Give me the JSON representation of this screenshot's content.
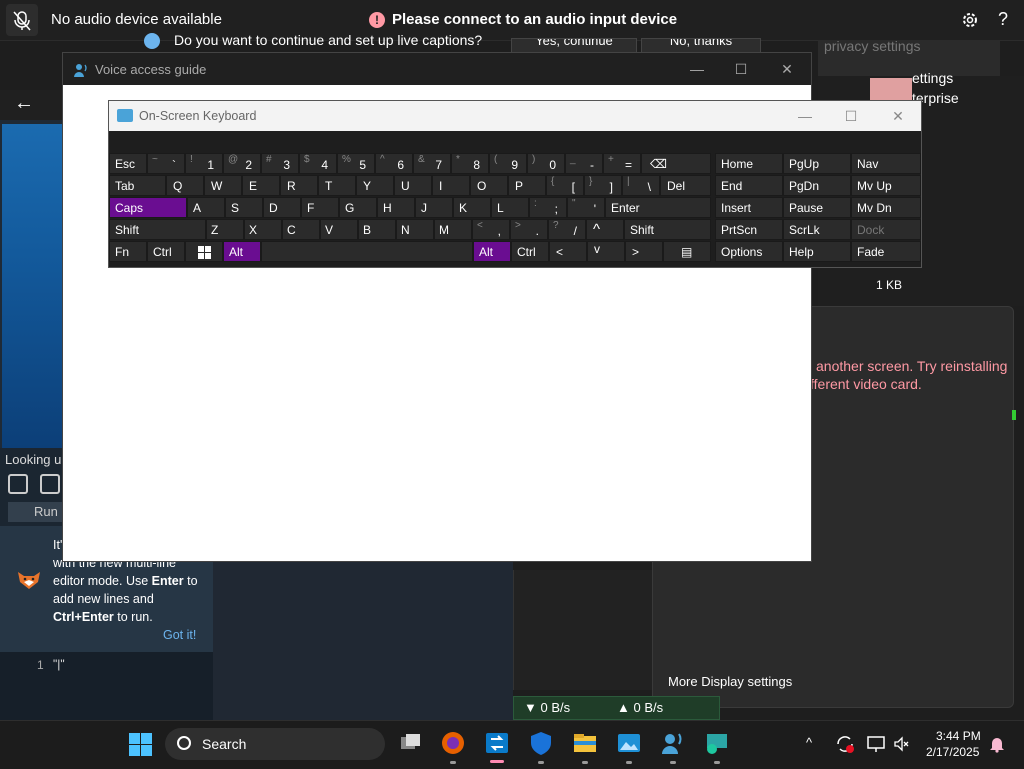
{
  "voice_bar": {
    "status": "No audio device available",
    "alert": "Please connect to an audio input device",
    "alert_icon": "!",
    "help": "?"
  },
  "captions_prompt": {
    "text": "Do you want to continue and set up live captions?",
    "continue_label": "Yes, continue",
    "decline_label": "No, thanks",
    "privacy_label": "privacy settings"
  },
  "background": {
    "looking_up": "Looking up",
    "run_label": "Run",
    "tip_line1": "It's",
    "tip_line2": "with the new multi-line",
    "tip_line3": "editor mode. Use",
    "tip_enter": "Enter",
    "tip_line3b": "to",
    "tip_line4": "add new lines and",
    "tip_ctrlenter": "Ctrl+Enter",
    "tip_line5": "to run.",
    "got_it": "Got it!",
    "line_number": "1",
    "line_code": "\"|\"",
    "settings_partial1": "ettings",
    "settings_partial2": "terprise",
    "file_size": "1 KB",
    "display_error1": "another screen. Try reinstalling",
    "display_error2": "fferent video card.",
    "more_display": "More Display settings",
    "net_down": "▼ 0 B/s",
    "net_up": "▲ 0 B/s"
  },
  "guide_window": {
    "title": "Voice access guide",
    "minimize": "—",
    "maximize": "☐",
    "close": "✕"
  },
  "osk": {
    "title": "On-Screen Keyboard",
    "minimize": "—",
    "maximize": "☐",
    "close": "✕",
    "keys": {
      "esc": "Esc",
      "tilde_s": "~",
      "tilde_p": "`",
      "n1_s": "!",
      "n1_p": "1",
      "n2_s": "@",
      "n2_p": "2",
      "n3_s": "#",
      "n3_p": "3",
      "n4_s": "$",
      "n4_p": "4",
      "n5_s": "%",
      "n5_p": "5",
      "n6_s": "^",
      "n6_p": "6",
      "n7_s": "&",
      "n7_p": "7",
      "n8_s": "*",
      "n8_p": "8",
      "n9_s": "(",
      "n9_p": "9",
      "n0_s": ")",
      "n0_p": "0",
      "minus_s": "_",
      "minus_p": "-",
      "eq_s": "+",
      "eq_p": "=",
      "backspace": "⌫",
      "tab": "Tab",
      "q": "Q",
      "w": "W",
      "e": "E",
      "r": "R",
      "t": "T",
      "y": "Y",
      "u": "U",
      "i": "I",
      "o": "O",
      "p": "P",
      "lbr_s": "{",
      "lbr_p": "[",
      "rbr_s": "}",
      "rbr_p": "]",
      "bs_s": "|",
      "bs_p": "\\",
      "del": "Del",
      "caps": "Caps",
      "a": "A",
      "s": "S",
      "d": "D",
      "f": "F",
      "g": "G",
      "h": "H",
      "j": "J",
      "k": "K",
      "l": "L",
      "semi_s": ":",
      "semi_p": ";",
      "quote_s": "\"",
      "quote_p": "'",
      "enter": "Enter",
      "shift": "Shift",
      "z": "Z",
      "x": "X",
      "c": "C",
      "v": "V",
      "b": "B",
      "n": "N",
      "m": "M",
      "comma_s": "<",
      "comma_p": ",",
      "dot_s": ">",
      "dot_p": ".",
      "slash_s": "?",
      "slash_p": "/",
      "up": "^",
      "shift_r": "Shift",
      "fn": "Fn",
      "ctrl": "Ctrl",
      "alt": "Alt",
      "alt_r": "Alt",
      "ctrl_r": "Ctrl",
      "left": "<",
      "down": "v",
      "right": ">",
      "menu": "▤",
      "home": "Home",
      "pgup": "PgUp",
      "nav": "Nav",
      "end": "End",
      "pgdn": "PgDn",
      "mvup": "Mv Up",
      "insert": "Insert",
      "pause": "Pause",
      "mvdn": "Mv Dn",
      "prtscn": "PrtScn",
      "scrlk": "ScrLk",
      "dock": "Dock",
      "options": "Options",
      "help": "Help",
      "fade": "Fade"
    }
  },
  "taskbar": {
    "search_placeholder": "Search",
    "chevron": "^",
    "time": "3:44 PM",
    "date": "2/17/2025"
  },
  "colors": {
    "accent_purple": "#6a0d91",
    "alert_pink": "#ff99a4",
    "taskbar_indicator": "#ff8ab3"
  }
}
